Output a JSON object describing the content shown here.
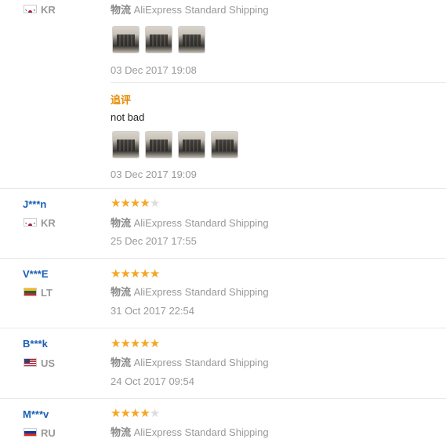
{
  "top_review": {
    "country_code": "KR",
    "shipping_label": "物流",
    "shipping_method": "AliExpress Standard Shipping",
    "date": "03 Dec 2017 19:08",
    "followup": {
      "title": "追评",
      "text": "not bad",
      "date": "03 Dec 2017 19:09"
    }
  },
  "reviews": [
    {
      "user": "J***n",
      "country_code": "KR",
      "rating": 4,
      "rating_max": 5,
      "shipping_label": "物流",
      "shipping_method": "AliExpress Standard Shipping",
      "date": "25 Dec 2017 17:55"
    },
    {
      "user": "V***E",
      "country_code": "LT",
      "rating": 5,
      "rating_max": 5,
      "shipping_label": "物流",
      "shipping_method": "AliExpress Standard Shipping",
      "date": "31 Oct 2017 22:54"
    },
    {
      "user": "B***k",
      "country_code": "US",
      "rating": 5,
      "rating_max": 5,
      "shipping_label": "物流",
      "shipping_method": "AliExpress Standard Shipping",
      "date": "24 Oct 2017 09:54"
    },
    {
      "user": "M***v",
      "country_code": "RU",
      "rating": 4,
      "rating_max": 5,
      "shipping_label": "物流",
      "shipping_method": "AliExpress Standard Shipping"
    }
  ],
  "colors": {
    "star": "#f5a623",
    "username": "#1a5fb4",
    "followup": "#e58a00"
  }
}
